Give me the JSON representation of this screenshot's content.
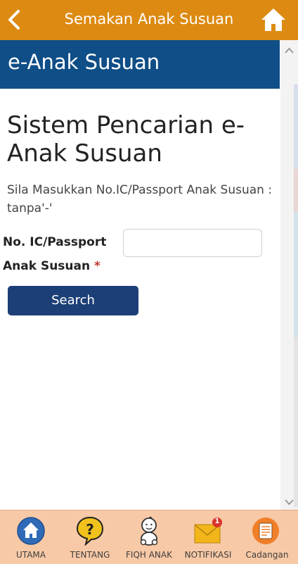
{
  "topbar": {
    "title": "Semakan Anak Susuan"
  },
  "header": {
    "title": "e-Anak Susuan"
  },
  "main": {
    "system_title": "Sistem Pencarian e-Anak Susuan",
    "instruction": "Sila Masukkan No.IC/Passport Anak Susuan : tanpa'-'",
    "ic_label": "No. IC/Passport Anak Susuan",
    "required_mark": "*",
    "ic_value": "",
    "search_label": "Search"
  },
  "bottom_nav": {
    "items": [
      {
        "label": "UTAMA",
        "icon": "home-icon"
      },
      {
        "label": "TENTANG",
        "icon": "question-icon"
      },
      {
        "label": "FIQH ANAK",
        "icon": "baby-icon"
      },
      {
        "label": "NOTIFIKASI",
        "icon": "mail-notification-icon",
        "badge": "1"
      },
      {
        "label": "Cadangan",
        "icon": "suggestion-icon"
      }
    ]
  },
  "colors": {
    "topbar": "#dd8a12",
    "header_band": "#0f4e87",
    "search_button": "#1c3f77",
    "bottom_nav": "#f8c9a6"
  }
}
